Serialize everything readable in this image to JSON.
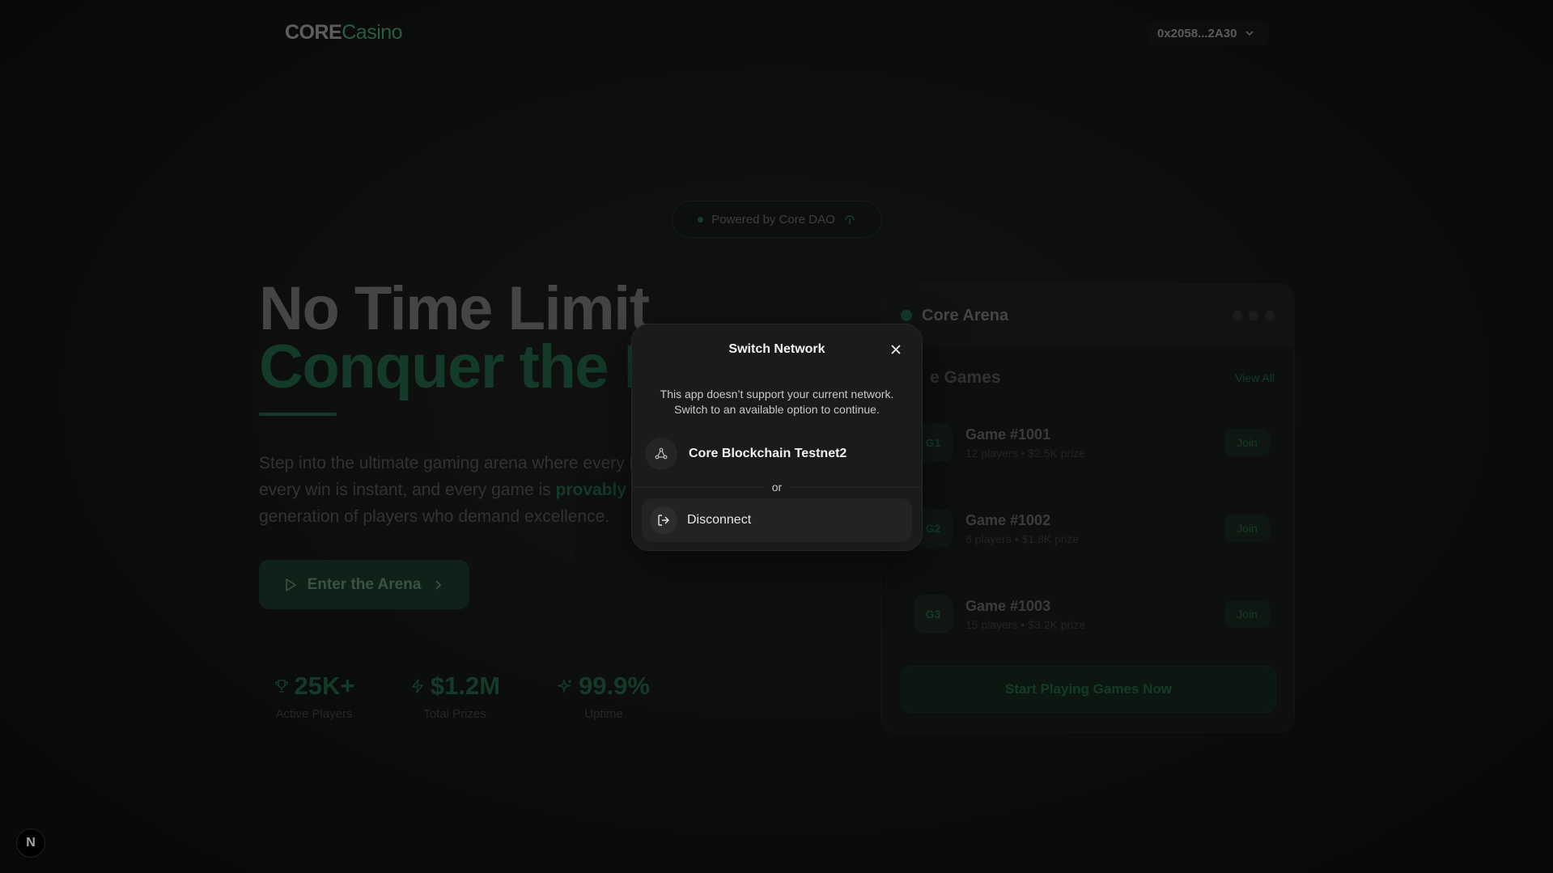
{
  "header": {
    "logo_core": "CORE",
    "logo_casino": "Casino",
    "wallet_address": "0x2058...2A30"
  },
  "badge": {
    "text": "Powered by Core DAO"
  },
  "hero": {
    "line1": "No Time Limit",
    "line2": "Conquer the I",
    "desc_line1": "Step into the ultimate gaming arena where every b",
    "desc_line2_plain": "every win is instant, and every game is ",
    "desc_line2_green": "provably fa",
    "desc_line3": "generation of players who demand excellence.",
    "cta_label": "Enter the Arena"
  },
  "stats": [
    {
      "value": "25K+",
      "label": "Active Players",
      "icon": "trophy-icon"
    },
    {
      "value": "$1.2M",
      "label": "Total Prizes",
      "icon": "lightning-icon"
    },
    {
      "value": "99.9%",
      "label": "Uptime",
      "icon": "sparkle-icon"
    }
  ],
  "arena": {
    "title": "Core Arena",
    "games_title": "e Games",
    "view_all": "View All",
    "games": [
      {
        "badge": "G1",
        "name": "Game #1001",
        "meta": "12 players • $2.5K prize",
        "join": "Join"
      },
      {
        "badge": "G2",
        "name": "Game #1002",
        "meta": "8 players • $1.8K prize",
        "join": "Join"
      },
      {
        "badge": "G3",
        "name": "Game #1003",
        "meta": "15 players • $3.2K prize",
        "join": "Join"
      }
    ],
    "start_label": "Start Playing Games Now"
  },
  "modal": {
    "title": "Switch Network",
    "message_line1": "This app doesn’t support your current network.",
    "message_line2": "Switch to an available option to continue.",
    "network_name": "Core Blockchain Testnet2",
    "or_text": "or",
    "disconnect_label": "Disconnect"
  },
  "dev_badge": {
    "text": "N"
  },
  "colors": {
    "accent": "#1f5a3f",
    "logo_accent": "#3f8f68",
    "modal_bg": "#1a1b1b"
  }
}
